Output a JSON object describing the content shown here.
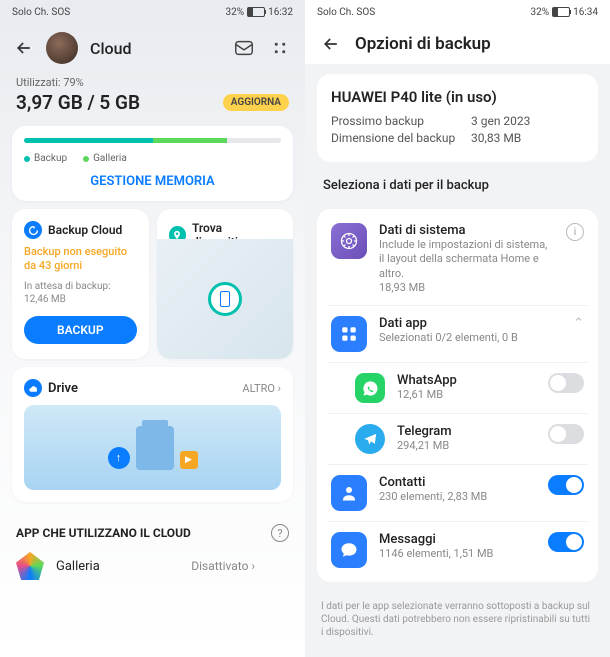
{
  "left": {
    "status": {
      "carrier": "Solo Ch. SOS",
      "battery": "32%",
      "time": "16:32"
    },
    "header": {
      "title": "Cloud"
    },
    "usage": {
      "label": "Utilizzati: 79%",
      "text": "3,97 GB / 5 GB",
      "update": "AGGIORNA"
    },
    "legend": {
      "backup": "Backup",
      "galleria": "Galleria"
    },
    "manage": "GESTIONE MEMORIA",
    "backupCard": {
      "title": "Backup Cloud",
      "warn": "Backup non eseguito da 43 giorni",
      "wait": "In attesa di backup: 12,46 MB",
      "btn": "BACKUP"
    },
    "findCard": {
      "title": "Trova dispositivo"
    },
    "drive": {
      "title": "Drive",
      "altro": "ALTRO"
    },
    "apps": {
      "title": "APP CHE UTILIZZANO IL CLOUD",
      "galleria": "Galleria",
      "status": "Disattivato"
    }
  },
  "right": {
    "status": {
      "carrier": "Solo Ch. SOS",
      "battery": "32%",
      "time": "16:34"
    },
    "title": "Opzioni di backup",
    "device": {
      "name": "HUAWEI P40 lite (in uso)",
      "nextLabel": "Prossimo backup",
      "nextVal": "3 gen 2023",
      "sizeLabel": "Dimensione del backup",
      "sizeVal": "30,83 MB"
    },
    "selectTitle": "Seleziona i dati per il backup",
    "sys": {
      "title": "Dati di sistema",
      "sub": "Include le impostazioni di sistema, il layout della schermata Home e altro.",
      "size": "18,93 MB"
    },
    "appData": {
      "title": "Dati app",
      "sub": "Selezionati 0/2 elementi, 0 B"
    },
    "wa": {
      "title": "WhatsApp",
      "sub": "12,61 MB"
    },
    "tg": {
      "title": "Telegram",
      "sub": "294,21 MB"
    },
    "contacts": {
      "title": "Contatti",
      "sub": "230 elementi, 2,83 MB"
    },
    "msg": {
      "title": "Messaggi",
      "sub": "1146 elementi, 1,51 MB"
    },
    "footer": "I dati per le app selezionate verranno sottoposti a backup sul Cloud. Questi dati potrebbero non essere ripristinabili su tutti i dispositivi."
  }
}
